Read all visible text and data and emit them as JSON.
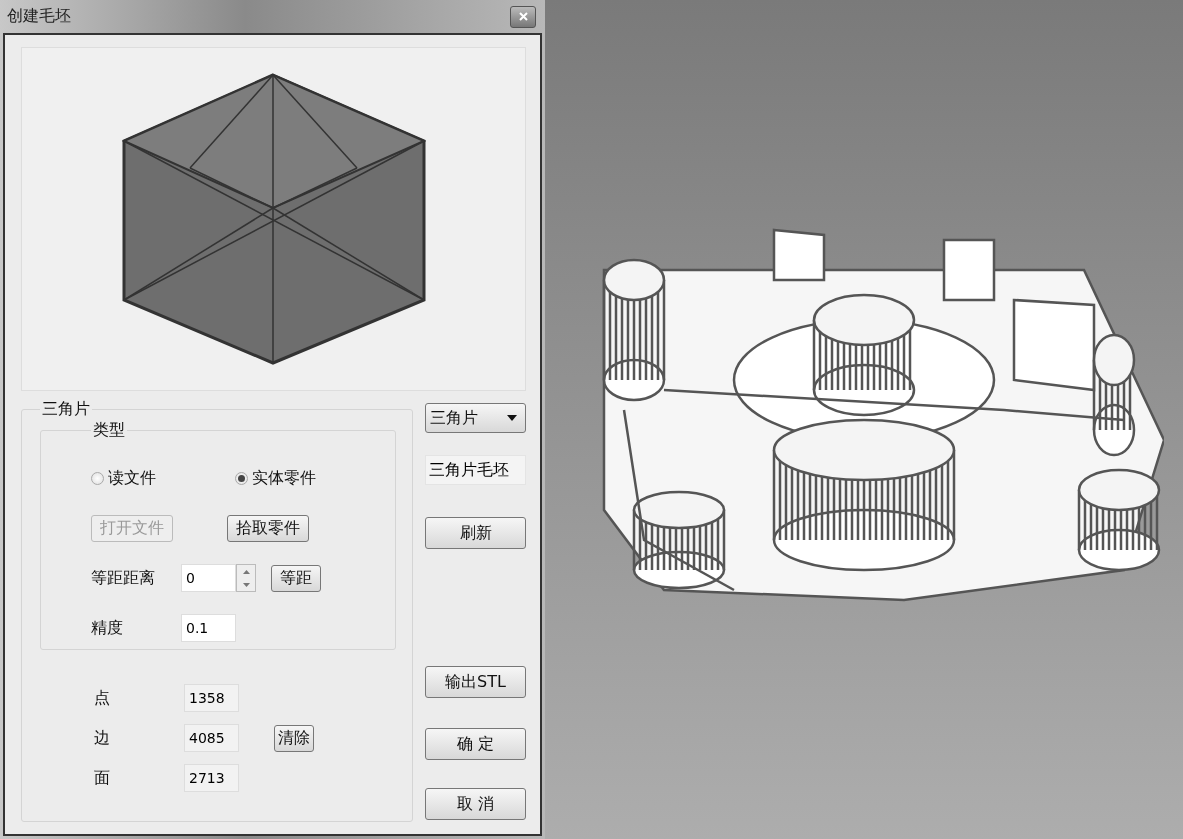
{
  "window": {
    "title": "创建毛坯"
  },
  "group": {
    "title": "三角片",
    "type_group": {
      "title": "类型",
      "options": [
        {
          "label": "读文件",
          "selected": false
        },
        {
          "label": "实体零件",
          "selected": true
        }
      ],
      "buttons": [
        {
          "label": "打开文件",
          "disabled": true
        },
        {
          "label": "拾取零件",
          "disabled": false
        }
      ],
      "offset": {
        "label": "等距距离",
        "value": "0",
        "button": "等距"
      },
      "precision": {
        "label": "精度",
        "value": "0.1"
      }
    },
    "stats": [
      {
        "label": "点",
        "value": "1358"
      },
      {
        "label": "边",
        "value": "4085"
      },
      {
        "label": "面",
        "value": "2713"
      }
    ],
    "clear_button": "清除"
  },
  "side": {
    "dropdown": "三角片",
    "name_field": "三角片毛坯",
    "refresh_button": "刷新",
    "export_button": "输出STL",
    "ok_button": "确 定",
    "cancel_button": "取 消"
  }
}
